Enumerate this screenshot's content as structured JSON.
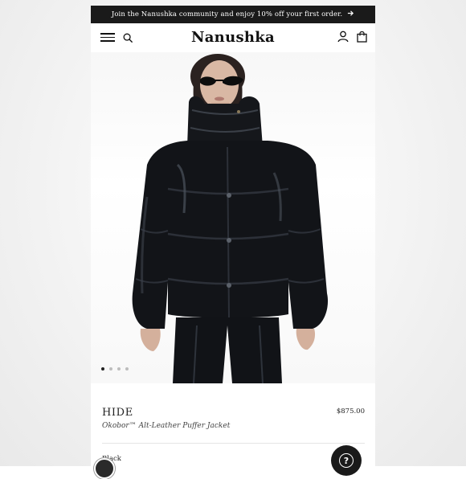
{
  "promo": {
    "text": "Join the Nanushka community and enjoy 10% off your first order.",
    "arrow_icon": "arrow-right-icon"
  },
  "header": {
    "logo": "Nanushka",
    "icons": [
      "menu-icon",
      "search-icon",
      "account-icon",
      "bag-icon"
    ]
  },
  "gallery": {
    "total_images": 4,
    "active_index": 0
  },
  "product": {
    "brand": "HIDE",
    "name": "Okobor™ Alt-Leather Puffer Jacket",
    "price": "$875.00",
    "color_label": "Black"
  },
  "help": {
    "icon": "question-mark-icon"
  },
  "colors": {
    "promo_bg": "#1a1a1a",
    "jacket": "#121418",
    "text": "#222222"
  }
}
